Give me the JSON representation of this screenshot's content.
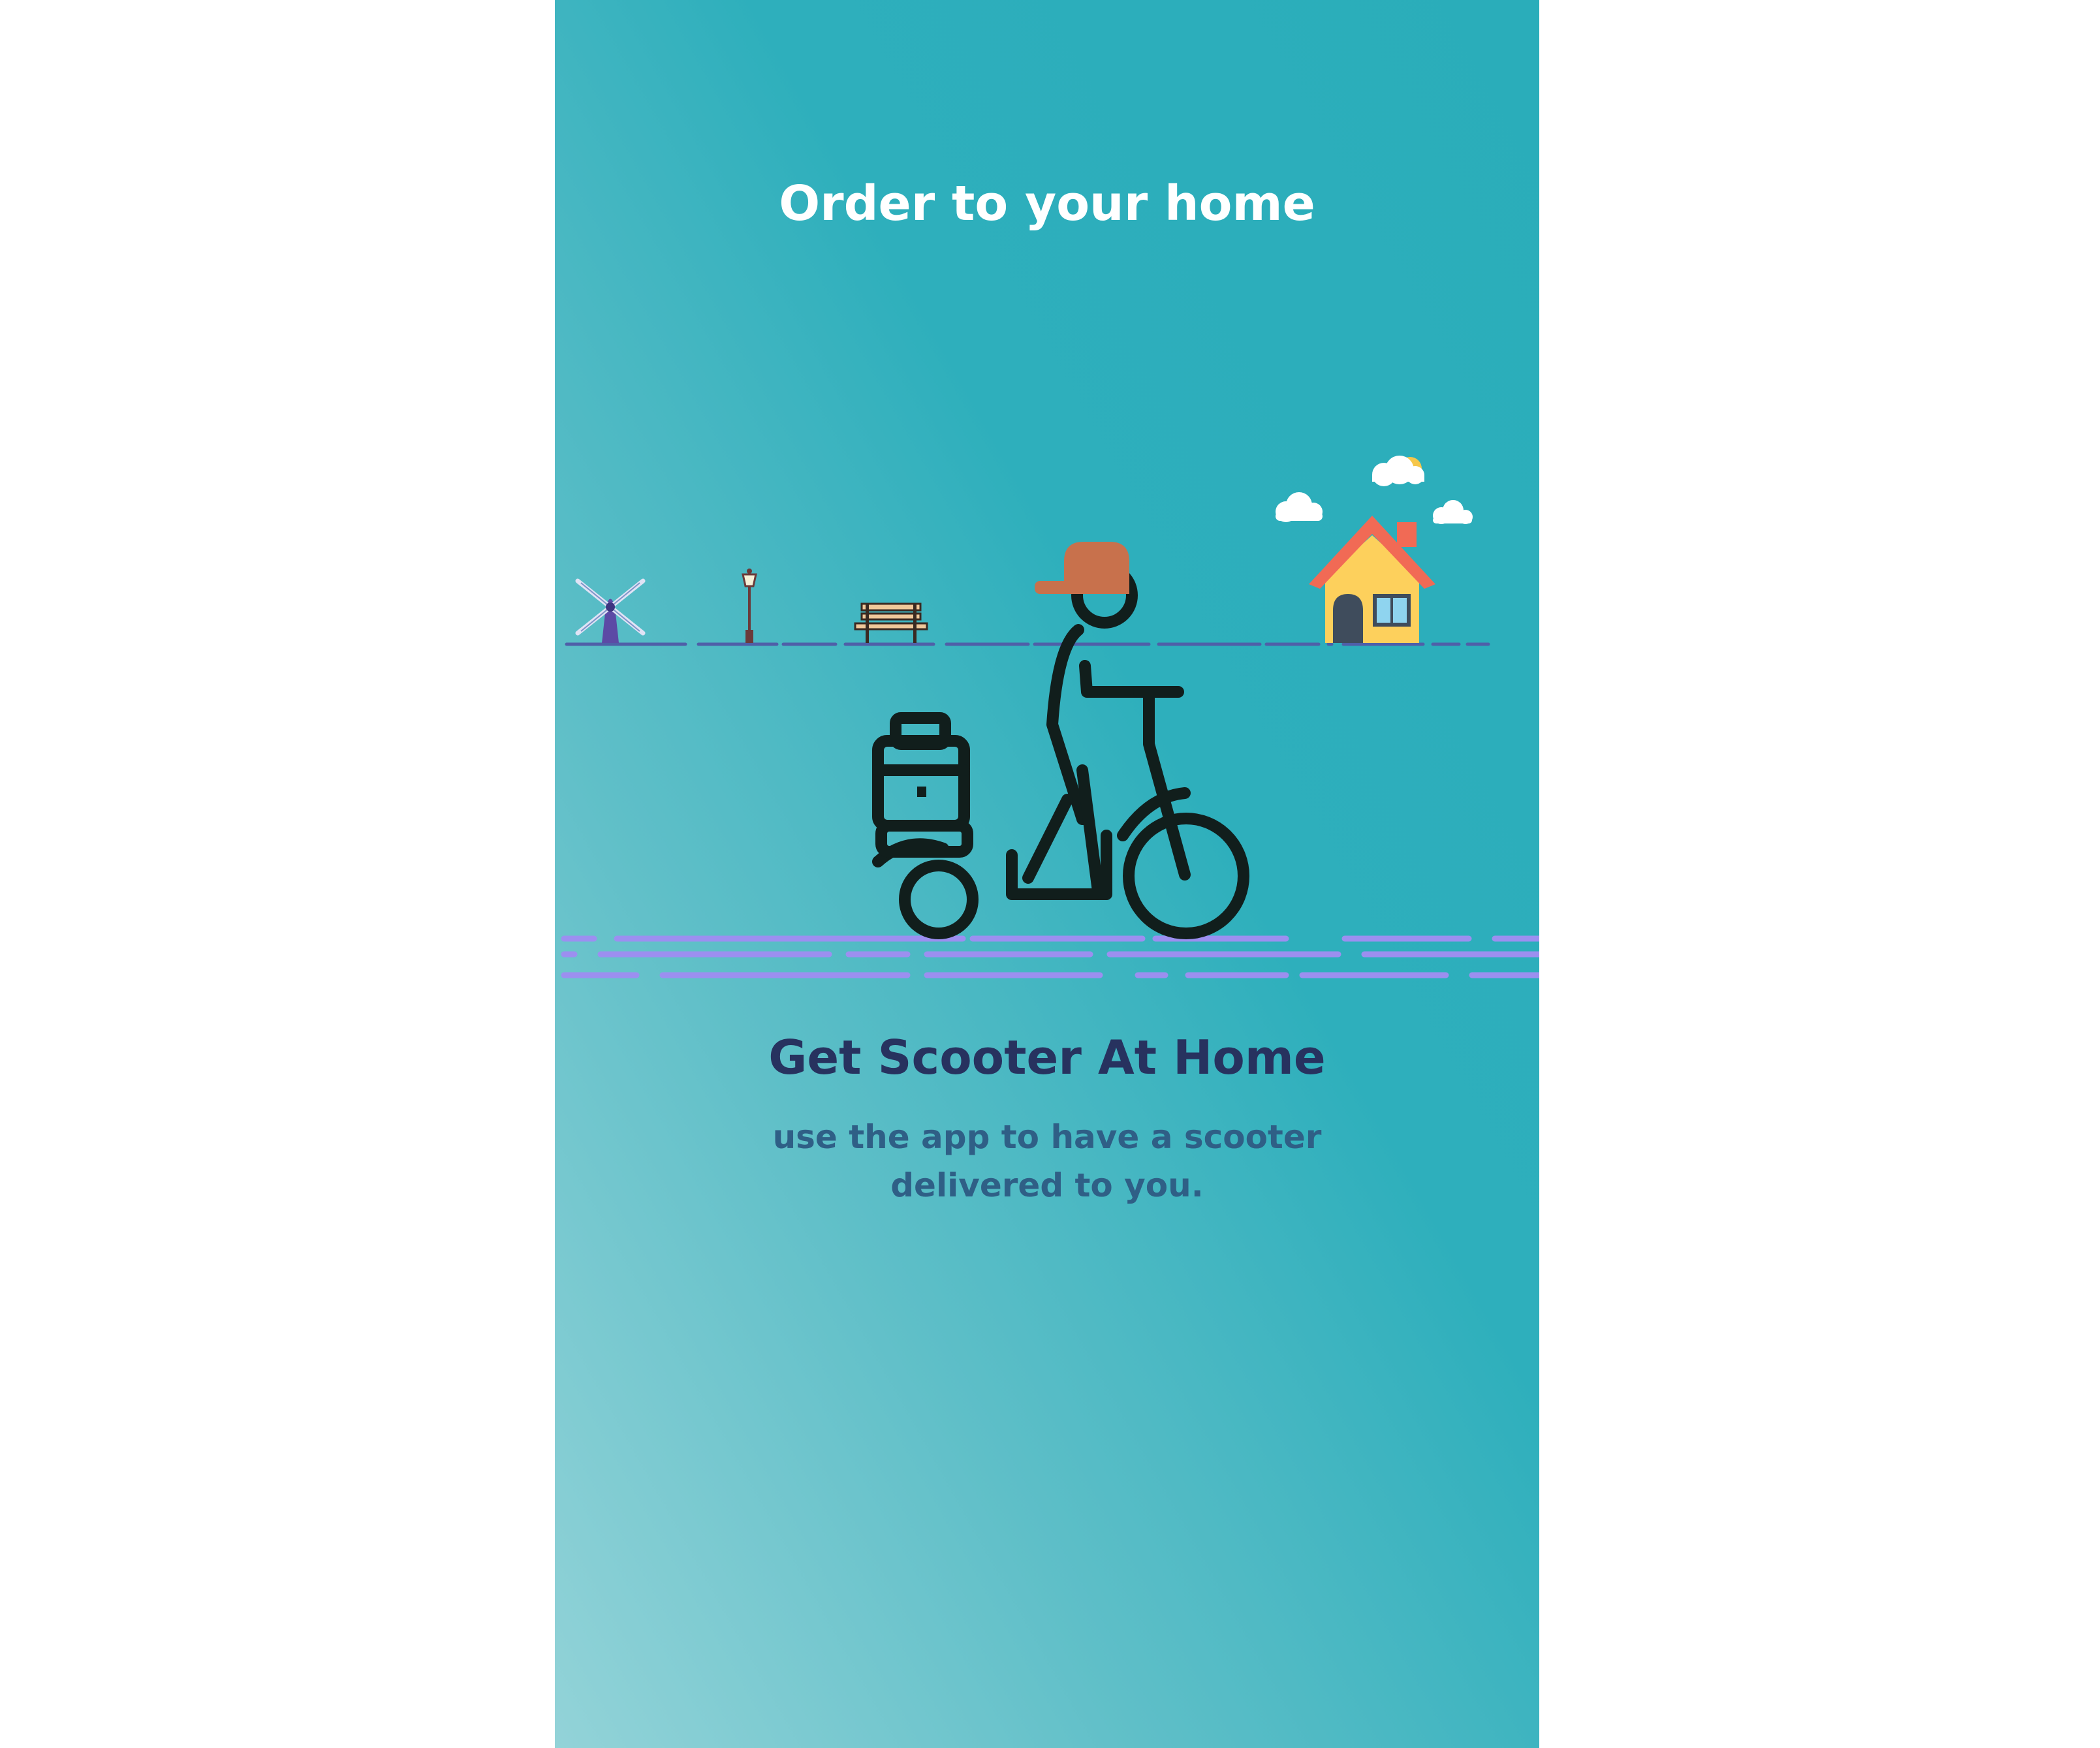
{
  "onboarding": {
    "top_title": "Order to your home",
    "heading": "Get Scooter At Home",
    "description": "use the app to have a scooter delivered to you."
  },
  "colors": {
    "background_top": "#2aadba",
    "background_bottom": "#93d3d8",
    "title_text": "#ffffff",
    "heading_text": "#27325f",
    "description_text": "#2f5f86",
    "horizon_line": "#4f5fa8",
    "road_lines": "#9c8ff0",
    "cap": "#c8714c",
    "rider_outline": "#111e1c",
    "house_wall": "#fdd05c",
    "house_roof": "#f16a55"
  },
  "illustration": {
    "icons": [
      "windmill-icon",
      "street-lamp-icon",
      "bench-icon",
      "delivery-rider-icon",
      "house-icon",
      "cloud-icon",
      "sun-icon"
    ]
  }
}
